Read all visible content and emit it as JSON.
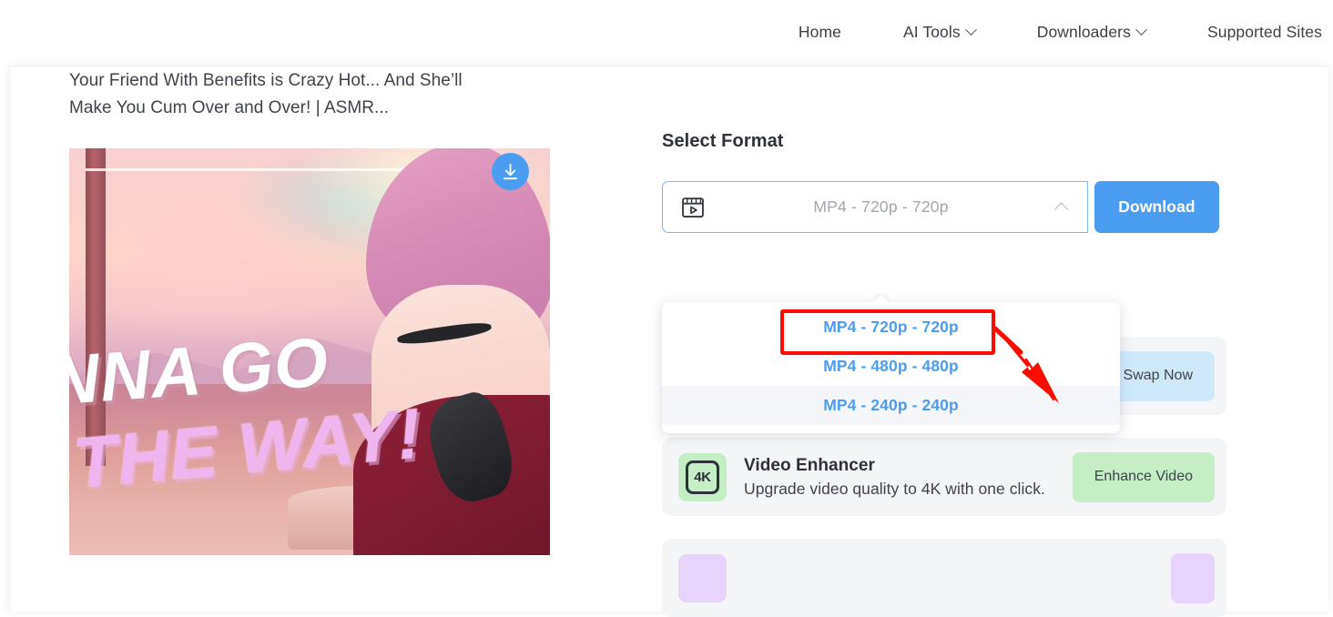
{
  "nav": {
    "items": [
      {
        "label": "Home",
        "has_caret": false
      },
      {
        "label": "AI Tools",
        "has_caret": true
      },
      {
        "label": "Downloaders",
        "has_caret": true
      },
      {
        "label": "Supported Sites",
        "has_caret": false
      }
    ]
  },
  "video": {
    "title": "Your Friend With Benefits is Crazy Hot... And She’ll Make You Cum Over and Over! | ASMR...",
    "thumbnail": {
      "overlay_line_1": "NNA GO",
      "overlay_line_2": "THE WAY!",
      "download_icon": "download-arrow-icon",
      "download_button_color": "#4a9df0"
    }
  },
  "format_section": {
    "title": "Select Format",
    "select": {
      "icon": "video-clapperboard-icon",
      "value": "MP4 - 720p - 720p",
      "chevron": "chevron-up-icon",
      "border_color": "#7cb8f2"
    },
    "download_button": {
      "label": "Download",
      "color": "#4a9df0"
    },
    "dropdown": {
      "open": true,
      "options": [
        {
          "label": "MP4 - 720p - 720p",
          "highlighted": false,
          "annotated": true
        },
        {
          "label": "MP4 - 480p - 480p",
          "highlighted": false,
          "annotated": false
        },
        {
          "label": "MP4 - 240p - 240p",
          "highlighted": true,
          "annotated": false
        }
      ],
      "option_color": "#4a9df0"
    }
  },
  "promos": [
    {
      "icon_text": "4K",
      "icon_name": "four-k-icon",
      "icon_bg": "#c6eec6",
      "heading": "Video Enhancer",
      "subtext": "Upgrade video quality to 4K with one click.",
      "button_label": "Enhance Video",
      "button_bg": "#c6eec6"
    },
    {
      "icon_text": "",
      "icon_name": "face-swap-icon",
      "icon_bg": "#cfe9fb",
      "heading": "",
      "subtext": "",
      "button_label": "e Swap Now",
      "button_bg": "#cfe9fb"
    },
    {
      "icon_text": "",
      "icon_name": "ai-art-icon",
      "icon_bg": "#e6d4fb",
      "heading": "",
      "subtext": "",
      "button_label": "",
      "button_bg": "#e6d4fb"
    }
  ],
  "annotation": {
    "color": "#fb0d00",
    "target_option": "MP4 - 720p - 720p",
    "shape": "rectangle-with-arrow"
  }
}
